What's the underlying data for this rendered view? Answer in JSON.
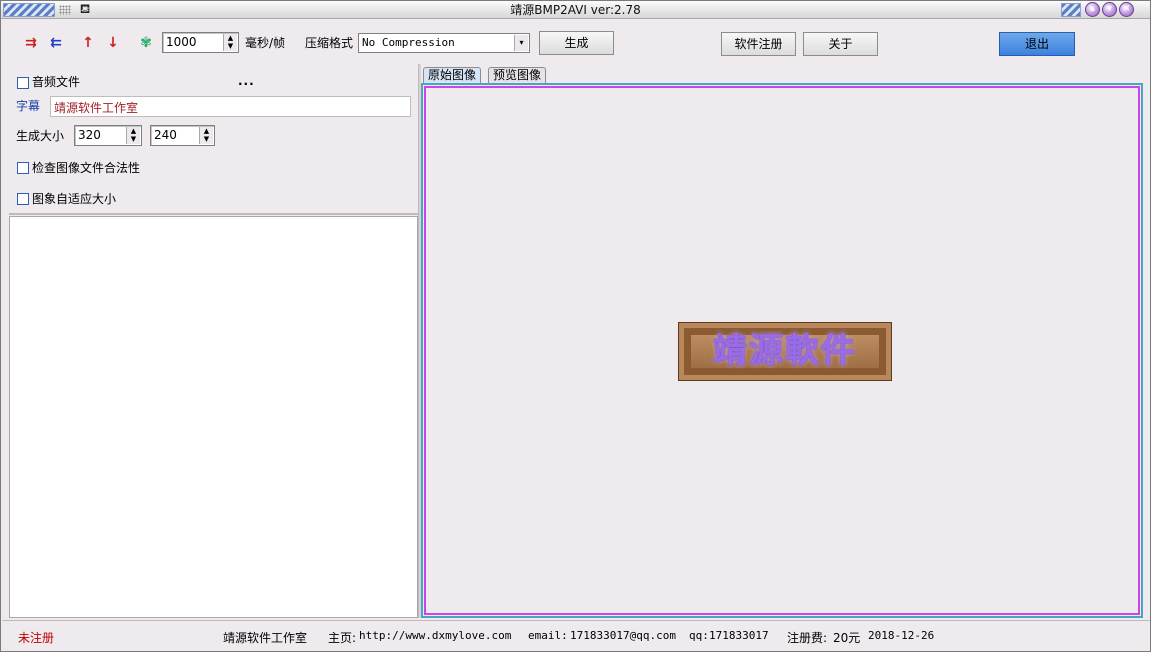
{
  "window": {
    "title": "靖源BMP2AVI ver:2.78"
  },
  "toolbar": {
    "frame_interval": "1000",
    "frame_unit": "毫秒/帧",
    "compression_label": "压缩格式",
    "compression_value": "No Compression",
    "generate_label": "生成",
    "register_label": "软件注册",
    "about_label": "关于",
    "exit_label": "退出"
  },
  "left": {
    "audio_label": "音频文件",
    "audio_browse": "...",
    "subtitle_label": "字幕",
    "subtitle_value": "靖源软件工作室",
    "size_label": "生成大小",
    "width": "320",
    "height": "240",
    "check_validity_label": "检查图像文件合法性",
    "auto_fit_label": "图象自适应大小"
  },
  "tabs": [
    "原始图像",
    "预览图像"
  ],
  "preview": {
    "logo_text": "靖源軟件"
  },
  "status": {
    "registration": "未注册",
    "studio": "靖源软件工作室",
    "homepage_label": "主页:",
    "homepage_url": "http://www.dxmylove.com",
    "email_label": "email:",
    "email": "171833017@qq.com",
    "qq_label": "qq:",
    "qq": "171833017",
    "fee_label": "注册费:",
    "fee": "20元",
    "date": "2018-12-26"
  },
  "colors": {
    "accent": "#3b82e0",
    "status_unregistered": "#c00000",
    "subtitle_text": "#a0202a",
    "subtitle_label": "#1d3fa8",
    "frame_outer": "#49a6bf",
    "frame_inner": "#c845f0"
  }
}
